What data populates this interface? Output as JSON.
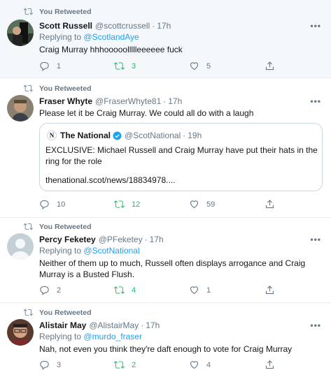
{
  "tweets": [
    {
      "retweet_label": "You Retweeted",
      "name": "Scott Russell",
      "handle": "@scottcrussell",
      "dot": "·",
      "time": "17h",
      "reply_prefix": "Replying to",
      "reply_to": "@ScotlandAye",
      "text": "Craig Murray hhhooooollllleeeeee fuck",
      "replies": "1",
      "retweets": "3",
      "likes": "5",
      "more": "•••"
    },
    {
      "retweet_label": "You Retweeted",
      "name": "Fraser Whyte",
      "handle": "@FraserWhyte81",
      "dot": "·",
      "time": "17h",
      "text": "Please let it be Craig Murray. We could all do with a laugh",
      "quote": {
        "logo": "N",
        "name": "The National",
        "handle": "@ScotNational",
        "dot": "·",
        "time": "19h",
        "text": "EXCLUSIVE: Michael Russell and Craig Murray have put their hats in the ring for the role",
        "link": "thenational.scot/news/18834978...."
      },
      "replies": "10",
      "retweets": "12",
      "likes": "59",
      "more": "•••"
    },
    {
      "retweet_label": "You Retweeted",
      "name": "Percy Feketey",
      "handle": "@PFeketey",
      "dot": "·",
      "time": "17h",
      "reply_prefix": "Replying to",
      "reply_to": "@ScotNational",
      "text": "Neither of them up to much, Russell often displays arrogance and Craig Murray is a Busted Flush.",
      "replies": "2",
      "retweets": "4",
      "likes": "1",
      "more": "•••"
    },
    {
      "retweet_label": "You Retweeted",
      "name": "Alistair May",
      "handle": "@AlistairMay",
      "dot": "·",
      "time": "17h",
      "reply_prefix": "Replying to",
      "reply_to": "@murdo_fraser",
      "text": "Nah, not even you think they're daft enough to vote for Craig Murray",
      "replies": "3",
      "retweets": "2",
      "likes": "4",
      "more": "•••"
    }
  ],
  "colors": {
    "accent": "#1da1f2",
    "retweet": "#17bf63",
    "muted": "#657786",
    "highlight_bg": "#f5f8fa"
  }
}
